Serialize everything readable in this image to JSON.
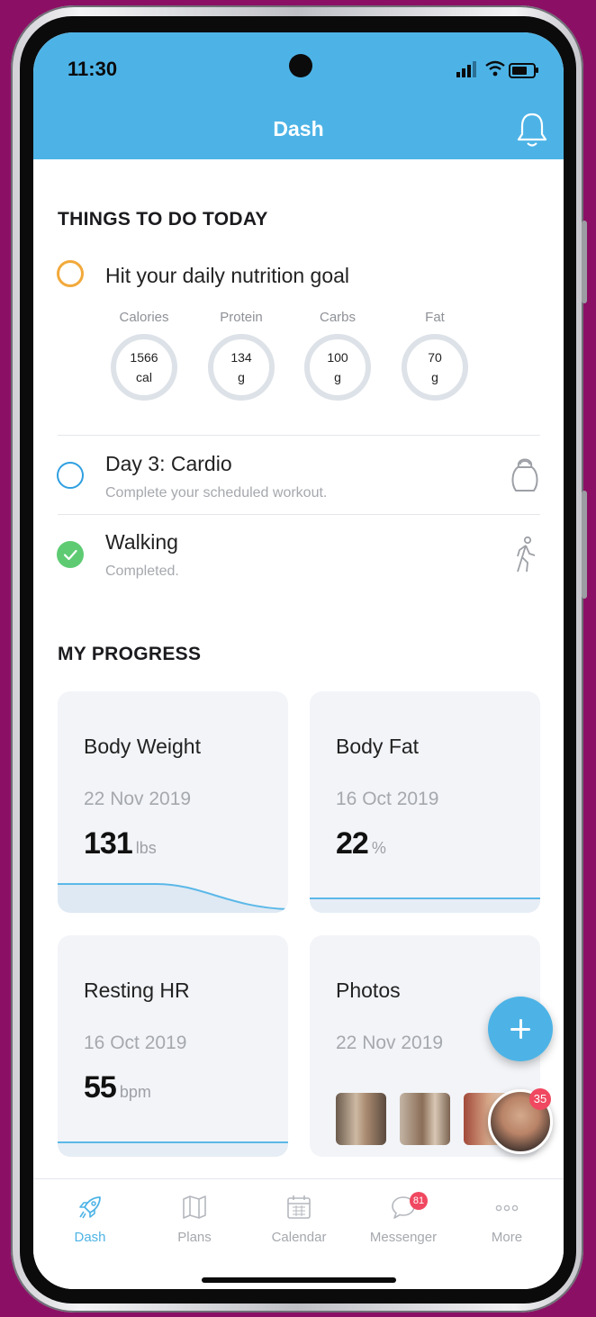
{
  "status": {
    "time": "11:30"
  },
  "header": {
    "title": "Dash",
    "bell_icon": "bell-icon"
  },
  "todo": {
    "section_title": "THINGS TO DO TODAY",
    "tasks": [
      {
        "title": "Hit your daily nutrition goal",
        "subtitle": "",
        "status": "pending",
        "status_color": "#f2a93b"
      },
      {
        "title": "Day 3: Cardio",
        "subtitle": "Complete your scheduled workout.",
        "status": "pending",
        "status_color": "#2f9fe0",
        "icon": "kettlebell-icon"
      },
      {
        "title": "Walking",
        "subtitle": "Completed.",
        "status": "completed",
        "status_color": "#5ecb73",
        "icon": "walking-icon"
      }
    ],
    "nutrition": [
      {
        "label": "Calories",
        "value": "1566",
        "unit": "cal"
      },
      {
        "label": "Protein",
        "value": "134",
        "unit": "g"
      },
      {
        "label": "Carbs",
        "value": "100",
        "unit": "g"
      },
      {
        "label": "Fat",
        "value": "70",
        "unit": "g"
      }
    ]
  },
  "progress": {
    "section_title": "MY PROGRESS",
    "cards": [
      {
        "title": "Body Weight",
        "date": "22 Nov 2019",
        "value": "131",
        "unit": "lbs"
      },
      {
        "title": "Body Fat",
        "date": "16 Oct 2019",
        "value": "22",
        "unit": "%"
      },
      {
        "title": "Resting HR",
        "date": "16 Oct 2019",
        "value": "55",
        "unit": "bpm"
      },
      {
        "title": "Photos",
        "date": "22 Nov 2019"
      }
    ]
  },
  "floating": {
    "add_icon": "plus-icon",
    "coach_badge": "35"
  },
  "tabbar": {
    "tabs": [
      {
        "label": "Dash",
        "icon": "rocket-icon",
        "active": true
      },
      {
        "label": "Plans",
        "icon": "map-icon",
        "active": false
      },
      {
        "label": "Calendar",
        "icon": "calendar-icon",
        "active": false
      },
      {
        "label": "Messenger",
        "icon": "chat-bubble-icon",
        "active": false,
        "badge": "81"
      },
      {
        "label": "More",
        "icon": "more-dots-icon",
        "active": false
      }
    ]
  },
  "colors": {
    "accent": "#4db3e6",
    "background": "#8b1065",
    "badge": "#f04860"
  }
}
